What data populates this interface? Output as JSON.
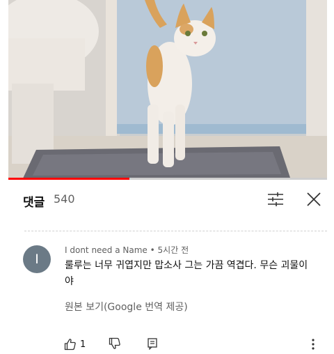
{
  "video": {
    "progress_percent": 38
  },
  "header": {
    "title": "댓글",
    "count": "540",
    "sort_icon": "sort-icon",
    "close_icon": "close-icon"
  },
  "comment": {
    "avatar_letter": "I",
    "author": "I dont need a Name",
    "separator": "•",
    "time": "5시간 전",
    "text": "룰루는 너무 귀엽지만 맙소사 그는 가끔 역겹다. 무슨 괴물이야",
    "translate_label": "원본 보기(Google 번역 제공)",
    "like_count": "1"
  },
  "actions_icons": [
    "thumbs-up-icon",
    "thumbs-down-icon",
    "reply-icon",
    "more-vertical-icon"
  ]
}
